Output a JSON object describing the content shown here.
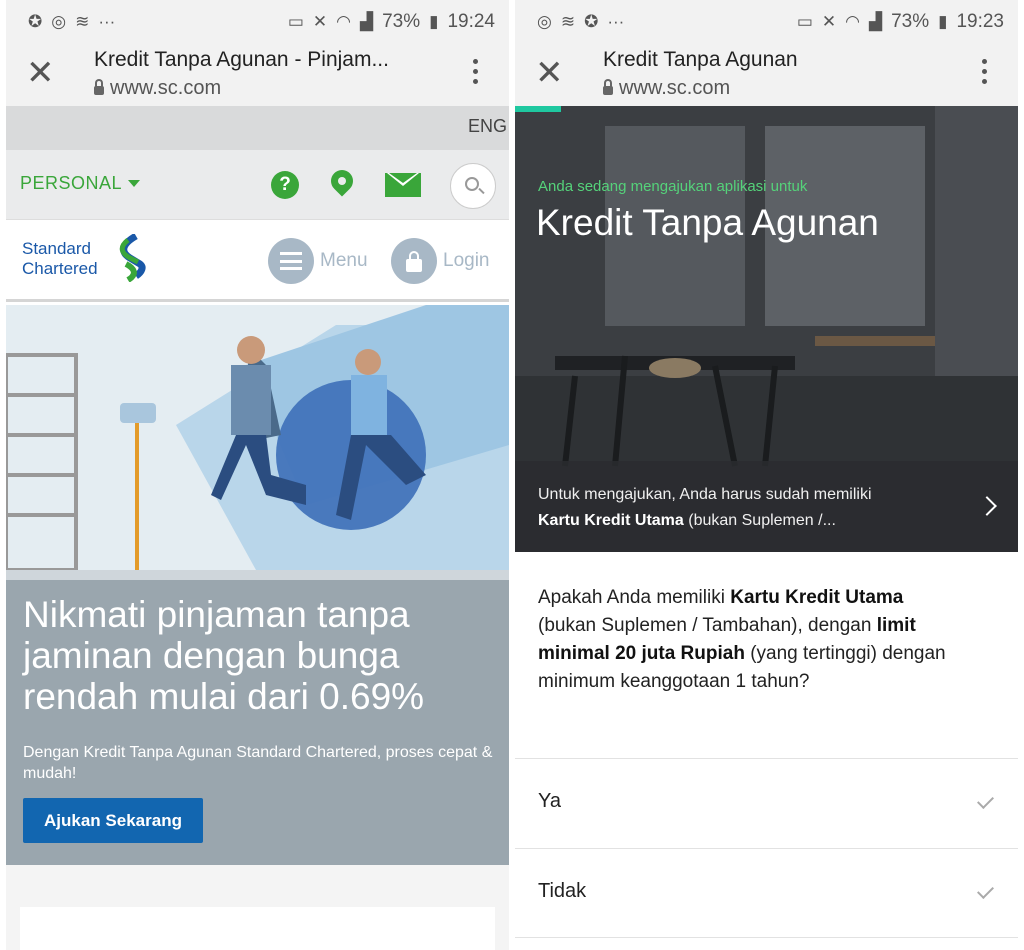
{
  "left": {
    "status": {
      "percent": "73%",
      "time": "19:24"
    },
    "browser": {
      "title": "Kredit Tanpa Agunan - Pinjam...",
      "host": "www.sc.com"
    },
    "lang": "ENG",
    "nav": {
      "segment": "PERSONAL",
      "help_glyph": "?",
      "menu_label": "Menu",
      "login_label": "Login"
    },
    "logo": {
      "line1": "Standard",
      "line2": "Chartered"
    },
    "promo": {
      "headline": "Nikmati pinjaman tanpa jaminan dengan bunga rendah mulai dari 0.69%",
      "sub": "Dengan Kredit Tanpa Agunan Standard Chartered, proses cepat & mudah!",
      "cta": "Ajukan Sekarang"
    }
  },
  "right": {
    "status": {
      "percent": "73%",
      "time": "19:23"
    },
    "browser": {
      "title": "Kredit Tanpa Agunan",
      "host": "www.sc.com"
    },
    "header": {
      "kicker": "Anda sedang mengajukan aplikasi untuk",
      "title": "Kredit Tanpa Agunan",
      "note_pre": "Untuk mengajukan, Anda harus sudah memiliki",
      "note_bold": "Kartu Kredit Utama",
      "note_post": " (bukan Suplemen /..."
    },
    "question": {
      "p1": "Apakah Anda memiliki ",
      "b1": "Kartu Kredit Utama",
      "p2": " (bukan Suplemen / Tambahan), dengan ",
      "b2": "limit minimal 20 juta Rupiah",
      "p3": " (yang tertinggi) dengan minimum keanggotaan 1 tahun?"
    },
    "options": [
      "Ya",
      "Tidak"
    ]
  },
  "colors": {
    "sc_green": "#3aa63a",
    "sc_blue": "#1266b0",
    "progress_teal": "#1fc8a0",
    "promo_grey": "#9aa6ae"
  },
  "icons": [
    "close-icon",
    "lock-icon",
    "kebab-menu-icon",
    "caret-down-icon",
    "help-icon",
    "location-pin-icon",
    "mail-icon",
    "search-icon",
    "hamburger-icon",
    "padlock-icon",
    "chevron-right-icon",
    "checkmark-icon"
  ]
}
